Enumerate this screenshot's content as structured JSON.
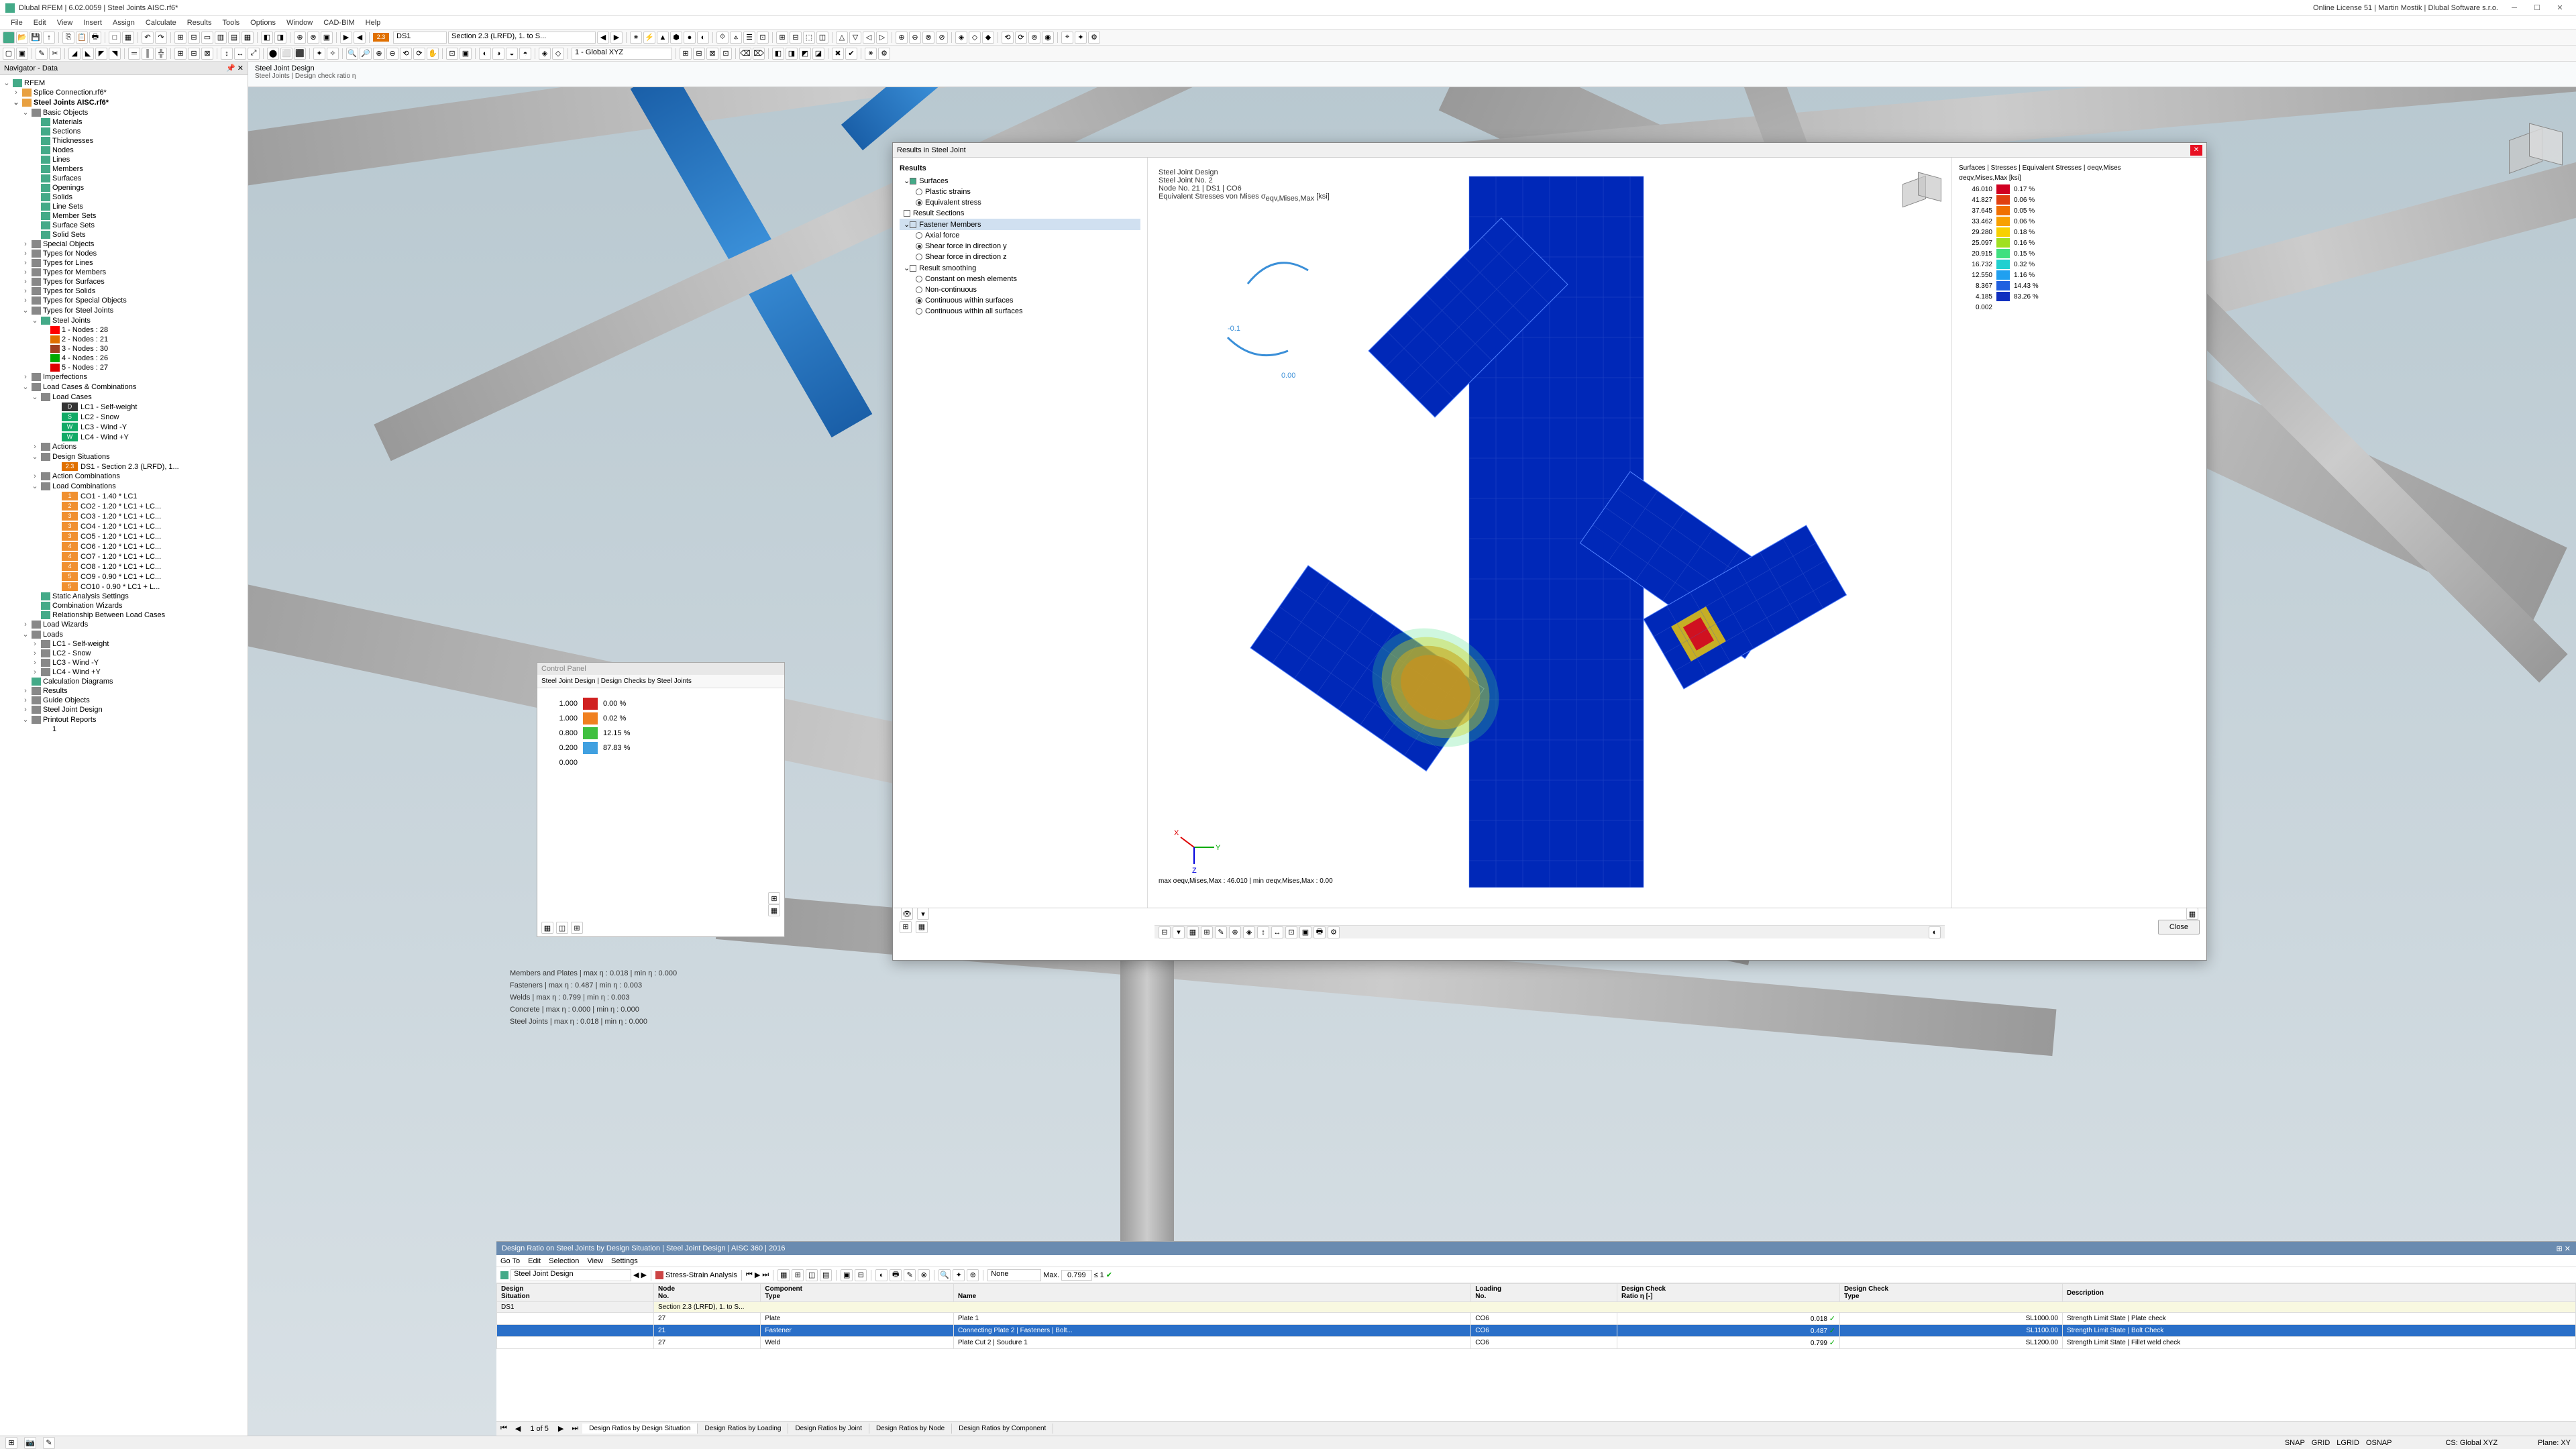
{
  "app": {
    "title": "Dlubal RFEM | 6.02.0059 | Steel Joints AISC.rf6*",
    "license": "Online License 51 | Martin Mostik | Dlubal Software s.r.o."
  },
  "menu": [
    "File",
    "Edit",
    "View",
    "Insert",
    "Assign",
    "Calculate",
    "Results",
    "Tools",
    "Options",
    "Window",
    "CAD-BIM",
    "Help"
  ],
  "toolbar2": {
    "badge23": "2.3",
    "ds1": "DS1",
    "section": "Section 2.3 (LRFD), 1. to S...",
    "coords": "1 - Global XYZ"
  },
  "nav": {
    "title": "Navigator - Data",
    "root": "RFEM",
    "splice": "Splice Connection.rf6*",
    "main_file": "Steel Joints AISC.rf6*",
    "basic": "Basic Objects",
    "basic_items": [
      "Materials",
      "Sections",
      "Thicknesses",
      "Nodes",
      "Lines",
      "Members",
      "Surfaces",
      "Openings",
      "Solids",
      "Line Sets",
      "Member Sets",
      "Surface Sets",
      "Solid Sets"
    ],
    "special": "Special Objects",
    "types": [
      "Types for Nodes",
      "Types for Lines",
      "Types for Members",
      "Types for Surfaces",
      "Types for Solids",
      "Types for Special Objects"
    ],
    "steel_joints": "Types for Steel Joints",
    "sj_group": "Steel Joints",
    "sj_items": [
      "1 - Nodes : 28",
      "2 - Nodes : 21",
      "3 - Nodes : 30",
      "4 - Nodes : 26",
      "5 - Nodes : 27"
    ],
    "imperfections": "Imperfections",
    "lcc": "Load Cases & Combinations",
    "load_cases": "Load Cases",
    "lcs": [
      {
        "b": "D",
        "c": "#333",
        "t": "LC1 - Self-weight"
      },
      {
        "b": "S",
        "c": "#1a6",
        "t": "LC2 - Snow"
      },
      {
        "b": "W",
        "c": "#1a6",
        "t": "LC3 - Wind -Y"
      },
      {
        "b": "W",
        "c": "#1a6",
        "t": "LC4 - Wind +Y"
      }
    ],
    "actions": "Actions",
    "design_sit": "Design Situations",
    "ds1": "DS1 - Section 2.3 (LRFD), 1...",
    "action_comb": "Action Combinations",
    "load_comb": "Load Combinations",
    "cos": [
      {
        "n": "1",
        "t": "CO1 - 1.40 * LC1"
      },
      {
        "n": "2",
        "t": "CO2 - 1.20 * LC1 + LC..."
      },
      {
        "n": "3",
        "t": "CO3 - 1.20 * LC1 + LC..."
      },
      {
        "n": "3",
        "t": "CO4 - 1.20 * LC1 + LC..."
      },
      {
        "n": "3",
        "t": "CO5 - 1.20 * LC1 + LC..."
      },
      {
        "n": "4",
        "t": "CO6 - 1.20 * LC1 + LC..."
      },
      {
        "n": "4",
        "t": "CO7 - 1.20 * LC1 + LC..."
      },
      {
        "n": "4",
        "t": "CO8 - 1.20 * LC1 + LC..."
      },
      {
        "n": "5",
        "t": "CO9 - 0.90 * LC1 + LC..."
      },
      {
        "n": "5",
        "t": "CO10 - 0.90 * LC1 + L..."
      }
    ],
    "sas": "Static Analysis Settings",
    "cw": "Combination Wizards",
    "rblc": "Relationship Between Load Cases",
    "lw": "Load Wizards",
    "loads": "Loads",
    "load_items": [
      "LC1 - Self-weight",
      "LC2 - Snow",
      "LC3 - Wind -Y",
      "LC4 - Wind +Y"
    ],
    "cd": "Calculation Diagrams",
    "results": "Results",
    "go": "Guide Objects",
    "sjd": "Steel Joint Design",
    "pr": "Printout Reports",
    "pr1": "1"
  },
  "content": {
    "header1": "Steel Joint Design",
    "header2": "Steel Joints | Design check ratio η"
  },
  "dialog": {
    "title": "Results in Steel Joint",
    "results": "Results",
    "surfaces": "Surfaces",
    "plastic": "Plastic strains",
    "equiv": "Equivalent stress",
    "rsec": "Result Sections",
    "fastener": "Fastener Members",
    "axial": "Axial force",
    "sheary": "Shear force in direction y",
    "shearz": "Shear force in direction z",
    "smooth": "Result smoothing",
    "const": "Constant on mesh elements",
    "noncont": "Non-continuous",
    "contws": "Continuous within surfaces",
    "contas": "Continuous within all surfaces",
    "info1": "Steel Joint Design",
    "info2": "Steel Joint No. 2",
    "info3": "Node No. 21 | DS1 | CO6",
    "info4": "Equivalent Stresses von Mises σ",
    "info4sub": "eqv,Mises,Max",
    "info4unit": " [ksi]",
    "minmax": "max σeqv,Mises,Max : 46.010 | min σeqv,Mises,Max : 0.00",
    "leg_title": "Surfaces | Stresses | Equivalent Stresses | σeqv,Mises",
    "leg_sub": "σeqv,Mises,Max [ksi]",
    "legend": [
      {
        "v": "46.010",
        "c": "#d00020",
        "p": "0.17 %"
      },
      {
        "v": "41.827",
        "c": "#e04010",
        "p": "0.06 %"
      },
      {
        "v": "37.645",
        "c": "#f07000",
        "p": "0.05 %"
      },
      {
        "v": "33.462",
        "c": "#f8a000",
        "p": "0.06 %"
      },
      {
        "v": "29.280",
        "c": "#f8d000",
        "p": "0.18 %"
      },
      {
        "v": "25.097",
        "c": "#a0e020",
        "p": "0.16 %"
      },
      {
        "v": "20.915",
        "c": "#40e080",
        "p": "0.15 %"
      },
      {
        "v": "16.732",
        "c": "#20d0d0",
        "p": "0.32 %"
      },
      {
        "v": "12.550",
        "c": "#20a0f0",
        "p": "1.16 %"
      },
      {
        "v": "8.367",
        "c": "#2060e0",
        "p": "14.43 %"
      },
      {
        "v": "4.185",
        "c": "#1030c0",
        "p": "83.26 %"
      },
      {
        "v": "0.002",
        "c": "",
        "p": ""
      }
    ],
    "close": "Close"
  },
  "cp": {
    "title": "Control Panel",
    "sub": "Steel Joint Design | Design Checks by Steel Joints",
    "rows": [
      {
        "v": "1.000",
        "c": "#d02020",
        "p": "0.00 %"
      },
      {
        "v": "1.000",
        "c": "#f08020",
        "p": "0.02 %"
      },
      {
        "v": "0.800",
        "c": "#40c040",
        "p": "12.15 %"
      },
      {
        "v": "0.200",
        "c": "#40a0e0",
        "p": "87.83 %"
      },
      {
        "v": "0.000",
        "c": "",
        "p": ""
      }
    ]
  },
  "summary": [
    "Members and Plates | max η : 0.018 | min η : 0.000",
    "Fasteners | max η : 0.487 | min η : 0.003",
    "Welds | max η : 0.799 | min η : 0.003",
    "Concrete | max η : 0.000 | min η : 0.000",
    "Steel Joints | max η : 0.018 | min η : 0.000"
  ],
  "lower": {
    "title": "Design Ratio on Steel Joints by Design Situation | Steel Joint Design | AISC 360 | 2016",
    "menu": [
      "Go To",
      "Edit",
      "Selection",
      "View",
      "Settings"
    ],
    "dropdown": "Steel Joint Design",
    "analysis": "Stress-Strain Analysis",
    "filter": "None",
    "max_label": "Max.",
    "max": "0.799",
    "le": "≤ 1",
    "headers": [
      "Design\nSituation",
      "Node\nNo.",
      "Component\nType",
      "\nName",
      "Loading\nNo.",
      "Design Check\nRatio η [-]",
      "Design Check\nType",
      "Description"
    ],
    "section": "Section 2.3 (LRFD), 1. to S...",
    "ds": "DS1",
    "rows": [
      {
        "n": "27",
        "t": "Plate",
        "nm": "Plate 1",
        "l": "CO6",
        "r": "0.018",
        "ck": "✓",
        "dc": "SL1000.00",
        "desc": "Strength Limit State | Plate check",
        "sel": false
      },
      {
        "n": "21",
        "t": "Fastener",
        "nm": "Connecting Plate 2 | Fasteners | Bolt...",
        "l": "CO6",
        "r": "0.487",
        "ck": "✓",
        "dc": "SL1100.00",
        "desc": "Strength Limit State | Bolt Check",
        "sel": true
      },
      {
        "n": "27",
        "t": "Weld",
        "nm": "Plate Cut 2 | Soudure 1",
        "l": "CO6",
        "r": "0.799",
        "ck": "✓",
        "dc": "SL1200.00",
        "desc": "Strength Limit State | Fillet weld check",
        "sel": false
      }
    ],
    "nav": "1 of 5",
    "tabs": [
      "Design Ratios by Design Situation",
      "Design Ratios by Loading",
      "Design Ratios by Joint",
      "Design Ratios by Node",
      "Design Ratios by Component"
    ]
  },
  "status": {
    "snap": "SNAP",
    "grid": "GRID",
    "lgrid": "LGRID",
    "osnap": "OSNAP",
    "cs": "CS: Global XYZ",
    "plane": "Plane: XY"
  }
}
